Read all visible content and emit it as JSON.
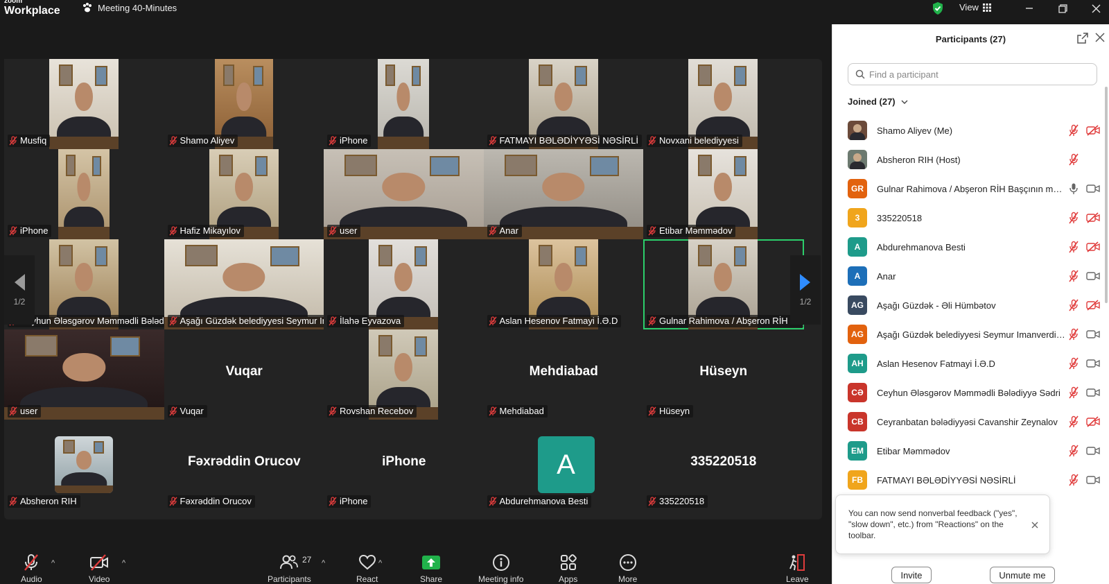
{
  "app": {
    "logo_line1": "zoom",
    "logo_line2": "Workplace",
    "meeting_title": "Meeting 40-Minutes",
    "view_label": "View"
  },
  "tiles": [
    {
      "name": "Musfiq",
      "type": "video"
    },
    {
      "name": "Shamo Aliyev",
      "type": "video"
    },
    {
      "name": "iPhone",
      "type": "video"
    },
    {
      "name": "FATMAYI BƏLƏDİYYƏSİ NƏSİRLİ",
      "type": "video"
    },
    {
      "name": "Novxani belediyyesi",
      "type": "video"
    },
    {
      "name": "iPhone",
      "type": "video"
    },
    {
      "name": "Hafiz Mikayılov",
      "type": "video"
    },
    {
      "name": "user",
      "type": "video"
    },
    {
      "name": "Anar",
      "type": "video"
    },
    {
      "name": "Etibar Məmmədov",
      "type": "video"
    },
    {
      "name": "Ceyhun Ələsgərov Məmmədli Bələdiyyə Sədri",
      "type": "video"
    },
    {
      "name": "Aşağı Güzdək belediyyesi Seymur Imanverdiyev",
      "type": "video"
    },
    {
      "name": "İlahə Eyvazova",
      "type": "video"
    },
    {
      "name": "Aslan Hesenov Fatmayi İ.Ə.D",
      "type": "video"
    },
    {
      "name": "Gulnar Rahimova / Abşeron RİH Başçının müavini",
      "type": "video",
      "active": true
    },
    {
      "name": "user",
      "type": "video"
    },
    {
      "name": "Vuqar",
      "type": "name",
      "display": "Vuqar"
    },
    {
      "name": "Rovshan Recebov",
      "type": "video"
    },
    {
      "name": "Mehdiabad",
      "type": "name",
      "display": "Mehdiabad"
    },
    {
      "name": "Hüseyn",
      "type": "name",
      "display": "Hüseyn"
    },
    {
      "name": "Absheron RIH",
      "type": "video"
    },
    {
      "name": "Fəxrəddin Orucov",
      "type": "name",
      "display": "Fəxrəddin Orucov"
    },
    {
      "name": "iPhone",
      "type": "name",
      "display": "iPhone"
    },
    {
      "name": "Abdurehmanova Besti",
      "type": "avatar",
      "display": "A"
    },
    {
      "name": "335220518",
      "type": "name",
      "display": "335220518"
    }
  ],
  "pager": {
    "left": "1/2",
    "right": "1/2"
  },
  "toolbar": {
    "audio": "Audio",
    "video": "Video",
    "participants": "Participants",
    "participants_count": "27",
    "react": "React",
    "share": "Share",
    "meeting_info": "Meeting info",
    "apps": "Apps",
    "more": "More",
    "leave": "Leave"
  },
  "panel": {
    "title": "Participants (27)",
    "search_placeholder": "Find a participant",
    "joined_label": "Joined (27)",
    "participants": [
      {
        "name": "Shamo Aliyev (Me)",
        "initials": "",
        "color": "#6b4a3a",
        "photo": true,
        "mic": "muted",
        "video": "off"
      },
      {
        "name": "Absheron RIH (Host)",
        "initials": "",
        "color": "#6d7a70",
        "photo": true,
        "mic": "muted",
        "video": "none"
      },
      {
        "name": "Gulnar Rahimova / Abşeron RİH Başçının müavini",
        "initials": "GR",
        "color": "#e2620e",
        "photo": false,
        "mic": "on",
        "video": "on"
      },
      {
        "name": "335220518",
        "initials": "3",
        "color": "#f0a51c",
        "photo": false,
        "mic": "muted",
        "video": "off"
      },
      {
        "name": "Abdurehmanova Besti",
        "initials": "A",
        "color": "#1e9b8a",
        "photo": false,
        "mic": "muted",
        "video": "off"
      },
      {
        "name": "Anar",
        "initials": "A",
        "color": "#1d6fb8",
        "photo": false,
        "mic": "muted",
        "video": "on"
      },
      {
        "name": "Aşağı Güzdək - Əli Hümbətov",
        "initials": "AG",
        "color": "#394a60",
        "photo": false,
        "mic": "muted",
        "video": "off"
      },
      {
        "name": "Aşağı Güzdək belediyyesi Seymur Imanverdiyev",
        "initials": "AG",
        "color": "#e2620e",
        "photo": false,
        "mic": "muted",
        "video": "on"
      },
      {
        "name": "Aslan Hesenov Fatmayi İ.Ə.D",
        "initials": "AH",
        "color": "#1e9b8a",
        "photo": false,
        "mic": "muted",
        "video": "on"
      },
      {
        "name": "Ceyhun Ələsgərov Məmmədli Bələdiyyə Sədri",
        "initials": "CƏ",
        "color": "#c9352b",
        "photo": false,
        "mic": "muted",
        "video": "on"
      },
      {
        "name": "Ceyranbatan bələdiyyəsi Cavanshir Zeynalov",
        "initials": "CB",
        "color": "#c9352b",
        "photo": false,
        "mic": "muted",
        "video": "off"
      },
      {
        "name": "Etibar Məmmədov",
        "initials": "EM",
        "color": "#1e9b8a",
        "photo": false,
        "mic": "muted",
        "video": "on"
      },
      {
        "name": "FATMAYI BƏLƏDİYYƏSİ NƏSİRLİ",
        "initials": "FB",
        "color": "#f0a51c",
        "photo": false,
        "mic": "muted",
        "video": "on"
      }
    ],
    "toast_text": "You can now send nonverbal feedback (\"yes\", \"slow down\", etc.) from \"Reactions\" on the toolbar.",
    "invite_label": "Invite",
    "unmute_label": "Unmute me"
  },
  "colors": {
    "accent_green": "#2ccf6b",
    "muted_red": "#e03c3c",
    "grid_bg": "#232323"
  }
}
